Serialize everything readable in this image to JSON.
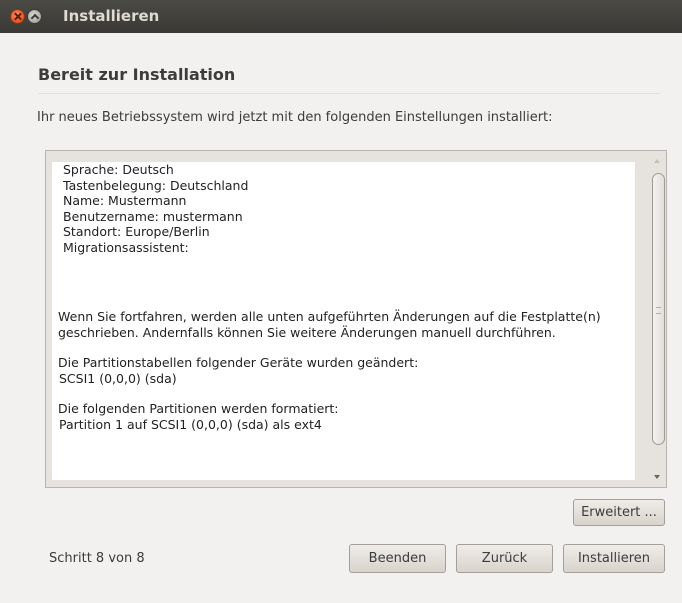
{
  "window": {
    "title": "Installieren"
  },
  "page": {
    "heading": "Bereit zur Installation",
    "intro": "Ihr neues Betriebssystem wird jetzt mit den folgenden Einstellungen installiert:"
  },
  "summary": {
    "settings": [
      "Sprache: Deutsch",
      "Tastenbelegung: Deutschland",
      "Name: Mustermann",
      "Benutzername: mustermann",
      "Standort: Europe/Berlin",
      "Migrationsassistent:"
    ],
    "warning": "Wenn Sie fortfahren, werden alle unten aufgeführten Änderungen auf die Festplatte(n) geschrieben. Andernfalls können Sie weitere Änderungen manuell durchführen.",
    "partition_tables_heading": "Die Partitionstabellen folgender Geräte wurden geändert:",
    "partition_tables_device": "SCSI1 (0,0,0) (sda)",
    "format_heading": "Die folgenden Partitionen werden formatiert:",
    "format_item": "Partition 1 auf SCSI1 (0,0,0) (sda) als ext4"
  },
  "buttons": {
    "advanced": "Erweitert ...",
    "quit": "Beenden",
    "back": "Zurück",
    "install": "Installieren"
  },
  "footer": {
    "step": "Schritt 8 von 8"
  }
}
